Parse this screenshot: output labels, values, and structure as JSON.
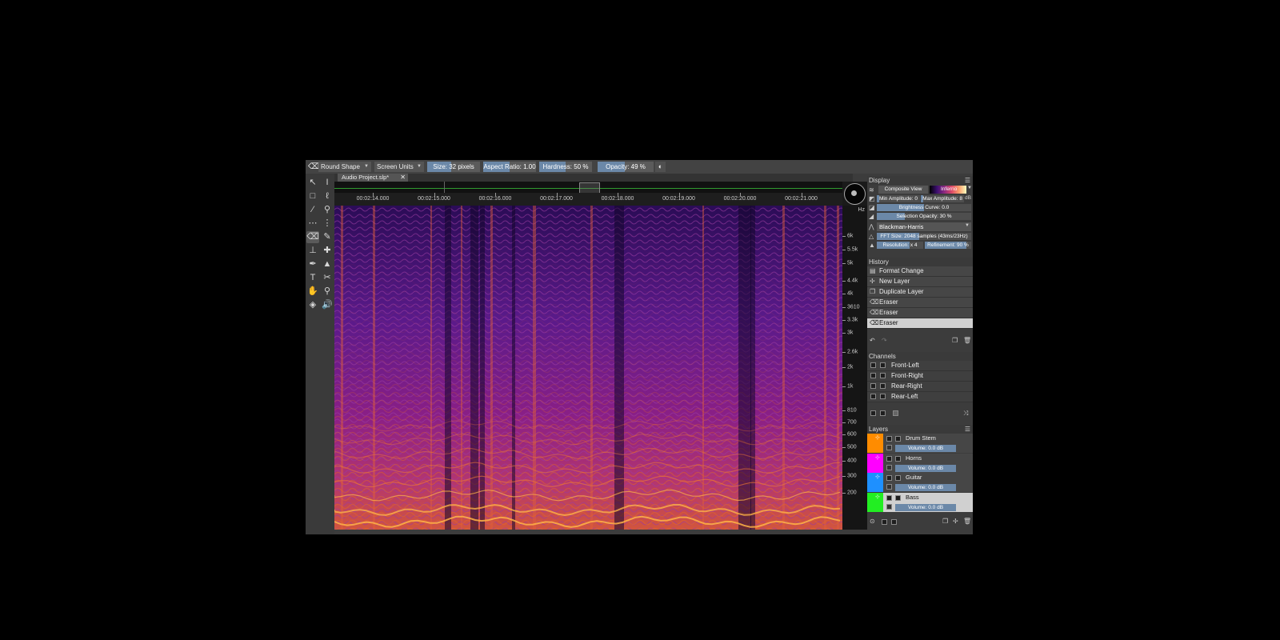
{
  "toolbar": {
    "brush_shape": "Round Shape",
    "units": "Screen Units",
    "size": {
      "label": "Size: 32 pixels",
      "fraction": 0.45
    },
    "aspect_ratio": {
      "label": "Aspect Ratio: 1.00",
      "fraction": 0.5
    },
    "hardness": {
      "label": "Hardness: 50 %",
      "fraction": 0.5
    },
    "opacity": {
      "label": "Opacity: 49 %",
      "fraction": 0.49
    }
  },
  "document": {
    "tab_title": "Audio Project.slp*"
  },
  "ruler": {
    "times": [
      "00:02:14.000",
      "00:02:15.000",
      "00:02:16.000",
      "00:02:17.000",
      "00:02:18.000",
      "00:02:19.000",
      "00:02:20.000",
      "00:02:21.000"
    ]
  },
  "hz_axis": {
    "unit": "Hz",
    "labels": [
      "6k",
      "5.5k",
      "5k",
      "4.4k",
      "4k",
      "3610",
      "3.3k",
      "3k",
      "2.6k",
      "2k",
      "1k",
      "810",
      "700",
      "600",
      "500",
      "400",
      "300",
      "200"
    ]
  },
  "display": {
    "title": "Display",
    "view_mode": "Composite View",
    "colormap": "Inferno",
    "min_amplitude_label": "Min Amplitude:",
    "min_amplitude_value": "0",
    "max_amplitude_label": "Max Amplitude:",
    "max_amplitude_value": "8",
    "db_unit": "dB",
    "brightness_curve": "Brightness Curve: 0.0",
    "selection_opacity": "Selection Opacity: 30 %",
    "window_function": "Blackman-Harris",
    "fft_size": "FFT Size: 2048 samples (43ms/23Hz)",
    "resolution": "Resolution: x 4",
    "refinement": "Refinement: 90 %"
  },
  "history": {
    "title": "History",
    "items": [
      {
        "label": "Format Change",
        "icon": "format-icon"
      },
      {
        "label": "New Layer",
        "icon": "new-layer-icon"
      },
      {
        "label": "Duplicate Layer",
        "icon": "duplicate-icon"
      },
      {
        "label": "Eraser",
        "icon": "eraser-icon"
      },
      {
        "label": "Eraser",
        "icon": "eraser-icon"
      },
      {
        "label": "Eraser",
        "icon": "eraser-icon"
      }
    ]
  },
  "channels": {
    "title": "Channels",
    "items": [
      "Front-Left",
      "Front-Right",
      "Rear-Right",
      "Rear-Left"
    ]
  },
  "layers": {
    "title": "Layers",
    "items": [
      {
        "name": "Drum Stem",
        "color": "#ff8c00",
        "volume": "Volume: 0.0 dB"
      },
      {
        "name": "Horns",
        "color": "#ff00ff",
        "volume": "Volume: 0.0 dB"
      },
      {
        "name": "Guitar",
        "color": "#1e90ff",
        "volume": "Volume: 0.0 dB"
      },
      {
        "name": "Bass",
        "color": "#22ee22",
        "volume": "Volume: 0.0 dB"
      }
    ]
  }
}
